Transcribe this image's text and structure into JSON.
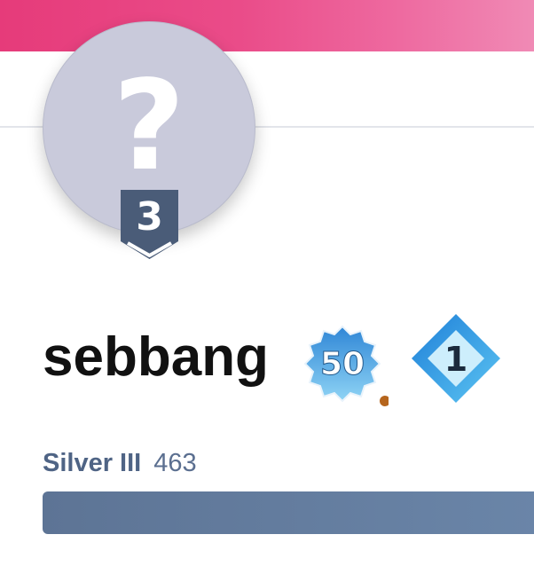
{
  "profile": {
    "avatar_glyph": "?",
    "level": "3",
    "username": "sebbang"
  },
  "badges": {
    "streak": {
      "value": "50",
      "icon": "burst-badge-icon",
      "indicator_color": "#b5651d"
    },
    "gem": {
      "value": "1",
      "icon": "diamond-badge-icon"
    }
  },
  "rank": {
    "name": "Silver III",
    "points": "463",
    "progress_fraction": 1.0
  },
  "colors": {
    "banner": "#ea4c89",
    "avatar": "#c9cadb",
    "level_badge": "#4a5c78",
    "progress": "#6a85a8",
    "rank_text": "#4f6485"
  }
}
